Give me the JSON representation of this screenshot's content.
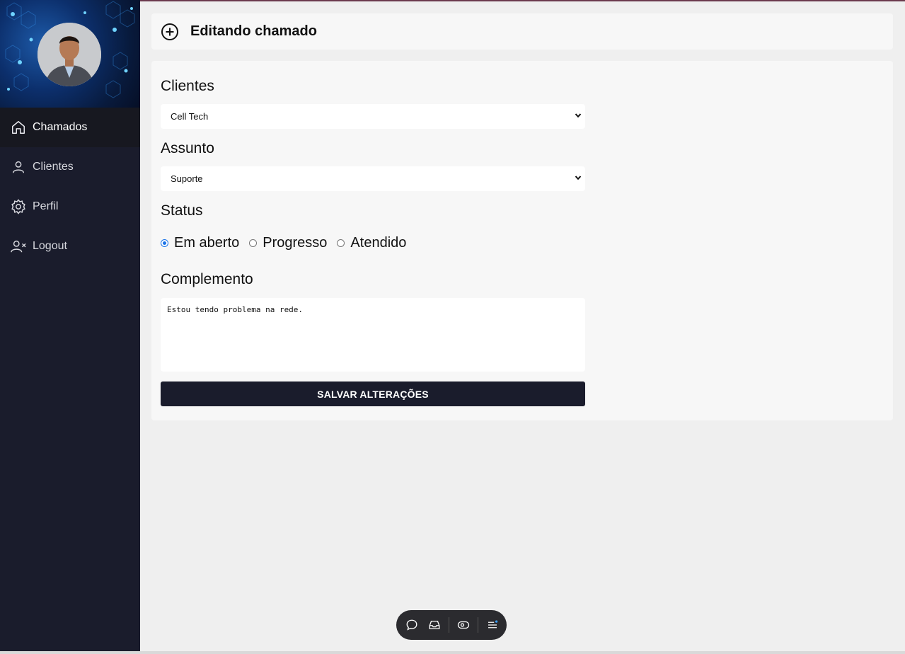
{
  "sidebar": {
    "items": [
      {
        "label": "Chamados",
        "icon": "home-icon",
        "active": true
      },
      {
        "label": "Clientes",
        "icon": "user-icon",
        "active": false
      },
      {
        "label": "Perfil",
        "icon": "gear-icon",
        "active": false
      },
      {
        "label": "Logout",
        "icon": "user-x-icon",
        "active": false
      }
    ]
  },
  "header": {
    "title": "Editando chamado",
    "icon": "plus-circle-icon"
  },
  "form": {
    "clientes": {
      "label": "Clientes",
      "selected": "Cell Tech"
    },
    "assunto": {
      "label": "Assunto",
      "selected": "Suporte"
    },
    "status": {
      "label": "Status",
      "options": [
        "Em aberto",
        "Progresso",
        "Atendido"
      ],
      "selected": "Em aberto"
    },
    "complemento": {
      "label": "Complemento",
      "value": "Estou tendo problema na rede."
    },
    "save_label": "SALVAR ALTERAÇÕES"
  },
  "dock": {
    "icons": [
      "chat-icon",
      "inbox-icon",
      "eye-icon",
      "menu-icon"
    ]
  },
  "colors": {
    "sidebar_bg": "#1a1c2c",
    "accent": "#1a73e8",
    "page_bg": "#efefef",
    "card_bg": "#f7f7f7"
  }
}
